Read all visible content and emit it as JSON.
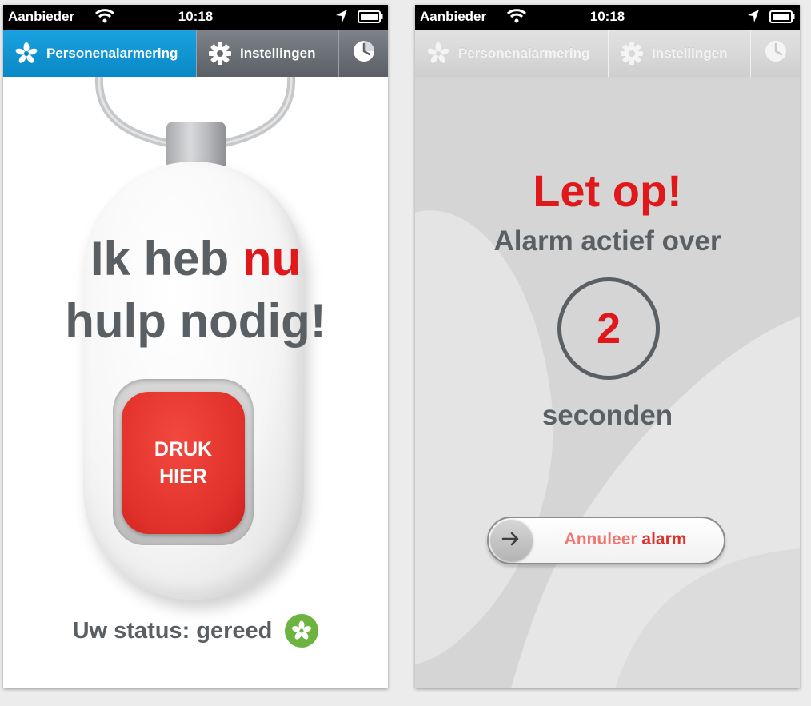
{
  "status_bar": {
    "carrier": "Aanbieder",
    "time": "10:18"
  },
  "tabs": {
    "main": "Personenalarmering",
    "settings": "Instellingen"
  },
  "alarm_screen": {
    "headline_1_part_1": "Ik heb ",
    "headline_1_part_2": "nu",
    "headline_2": "hulp nodig!",
    "button_line_1": "DRUK",
    "button_line_2": "HIER",
    "status_text": "Uw status: gereed"
  },
  "countdown_screen": {
    "title": "Let op!",
    "subtitle": "Alarm actief over",
    "count": "2",
    "unit": "seconden",
    "cancel_part_1": "Annuleer ",
    "cancel_part_2": "alarm"
  },
  "colors": {
    "brand_blue": "#0a88c6",
    "alert_red": "#e0181c",
    "text_gray": "#5a5f64",
    "status_green": "#6cb33f"
  },
  "icons": {
    "main_tab": "flower-logo-icon",
    "settings_tab": "gear-icon",
    "history_tab": "clock-icon",
    "status": "flower-logo-icon",
    "slider": "arrow-right-icon"
  }
}
